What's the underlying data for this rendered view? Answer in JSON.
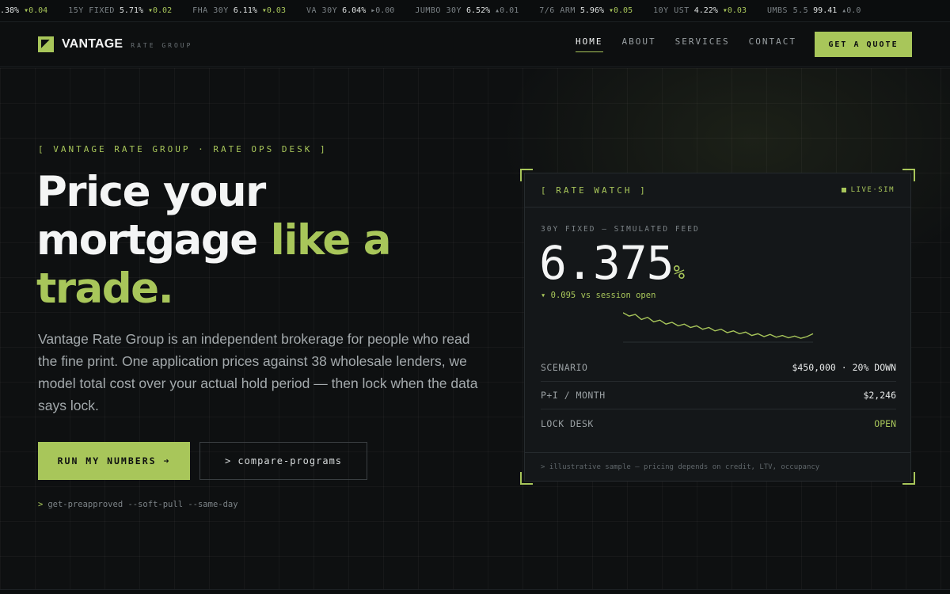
{
  "ticker": [
    {
      "label": "",
      "value": ".38%",
      "change": "▾0.04",
      "dir": "down"
    },
    {
      "label": "15Y FIXED",
      "value": "5.71%",
      "change": "▾0.02",
      "dir": "down"
    },
    {
      "label": "FHA 30Y",
      "value": "6.11%",
      "change": "▾0.03",
      "dir": "down"
    },
    {
      "label": "VA 30Y",
      "value": "6.04%",
      "change": "▸0.00",
      "dir": "flat"
    },
    {
      "label": "JUMBO 30Y",
      "value": "6.52%",
      "change": "▴0.01",
      "dir": "flat"
    },
    {
      "label": "7/6 ARM",
      "value": "5.96%",
      "change": "▾0.05",
      "dir": "down"
    },
    {
      "label": "10Y UST",
      "value": "4.22%",
      "change": "▾0.03",
      "dir": "down"
    },
    {
      "label": "UMBS 5.5",
      "value": "99.41",
      "change": "▴0.0",
      "dir": "flat"
    }
  ],
  "brand": {
    "name": "VANTAGE",
    "sub": "RATE GROUP"
  },
  "nav": {
    "links": [
      "HOME",
      "ABOUT",
      "SERVICES",
      "CONTACT"
    ],
    "cta": "GET A QUOTE"
  },
  "hero": {
    "eyebrow": "[ VANTAGE RATE GROUP · RATE OPS DESK ]",
    "headline_1": "Price your",
    "headline_2": "mortgage",
    "headline_accent_1": "like a",
    "headline_accent_2": "trade.",
    "body": "Vantage Rate Group is an independent brokerage for people who read the fine print. One application prices against 38 wholesale lenders, we model total cost over your actual hold period — then lock when the data says lock.",
    "cta_primary": "RUN MY NUMBERS ➜",
    "cta_secondary": "> compare-programs",
    "cmd_prompt": ">",
    "cmd_text": "get-preapproved --soft-pull --same-day"
  },
  "card": {
    "title": "[ RATE WATCH ]",
    "live": "LIVE·SIM",
    "feed_label": "30Y FIXED — SIMULATED FEED",
    "rate": "6.375",
    "rate_unit": "%",
    "delta": "▾ 0.095 vs session open",
    "sparkline": [
      8.6,
      8.0,
      8.3,
      7.4,
      7.8,
      7.0,
      7.3,
      6.6,
      6.9,
      6.3,
      6.6,
      6.0,
      6.3,
      5.7,
      6.0,
      5.4,
      5.7,
      5.1,
      5.4,
      4.9,
      5.2,
      4.6,
      4.9,
      4.4,
      4.8,
      4.3,
      4.6,
      4.2,
      4.5,
      4.1,
      4.4,
      4.9
    ],
    "rows": [
      {
        "label": "SCENARIO",
        "value": "$450,000 · 20% DOWN"
      },
      {
        "label": "P+I / MONTH",
        "value": "$2,246"
      },
      {
        "label": "LOCK DESK",
        "value": "OPEN"
      }
    ],
    "foot": "> illustrative sample — pricing depends on credit, LTV, occupancy"
  },
  "colors": {
    "accent": "#a8c65a",
    "background": "#0d0f10"
  }
}
